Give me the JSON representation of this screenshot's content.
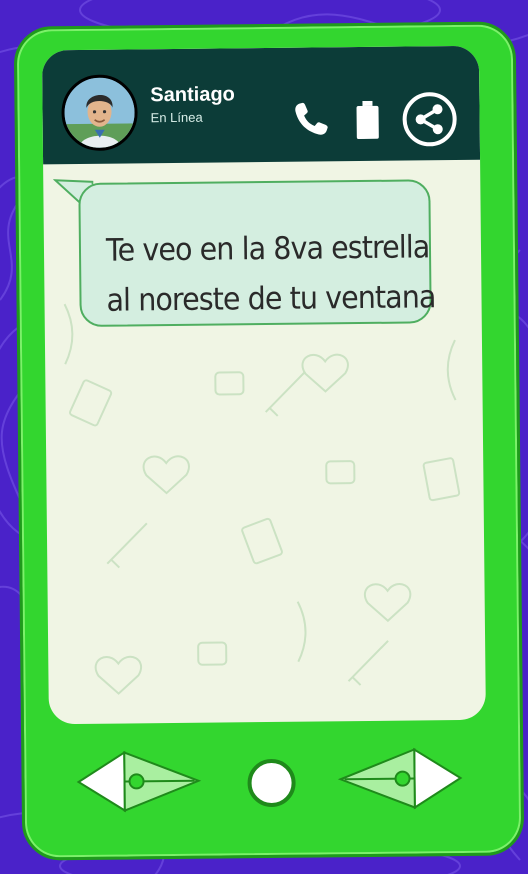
{
  "contact": {
    "name": "Santiago",
    "status": "En Línea"
  },
  "header_icons": [
    "phone-icon",
    "battery-icon",
    "share-icon"
  ],
  "message": {
    "line1": "Te veo en la 8va estrella",
    "line2": "al noreste de tu ventana"
  },
  "nav_buttons": [
    "back-arrow",
    "home-circle",
    "forward-arrow"
  ],
  "colors": {
    "background": "#4a22c9",
    "phone_body": "#33d62f",
    "header": "#0c3c38",
    "screen": "#f0f5e4",
    "bubble": "#d4eee0",
    "bubble_border": "#4fae60"
  }
}
